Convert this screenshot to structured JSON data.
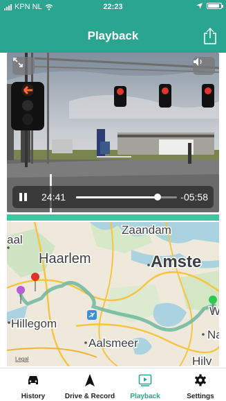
{
  "status_bar": {
    "carrier": "KPN NL",
    "time": "22:23",
    "battery_level": 0.9,
    "signal_bars": 4,
    "icons": [
      "wifi-icon",
      "location-arrow-icon",
      "battery-icon"
    ]
  },
  "nav": {
    "title": "Playback",
    "share_icon": "share-icon"
  },
  "video": {
    "fullscreen_icon": "expand-icon",
    "volume_icon": "speaker-icon",
    "elapsed": "24:41",
    "remaining": "-05:58",
    "progress": 0.81
  },
  "map": {
    "labels": {
      "zaandam": "Zaandam",
      "haarlem": "Haarlem",
      "amsterdam": "Amste",
      "hillegom": "Hillegom",
      "aalsmeer": "Aalsmeer",
      "aal": "aal",
      "na": "Na",
      "w": "W",
      "hilv": "Hilv",
      "legal": "Legal"
    },
    "pin_colors": {
      "start": "#2ec94f",
      "end": "#e0302a",
      "waypoint": "#b85bd6"
    },
    "route_color": "#6fb79f"
  },
  "tabs": [
    {
      "label": "History",
      "icon": "car-icon",
      "active": false
    },
    {
      "label": "Drive & Record",
      "icon": "navigation-arrow-icon",
      "active": false
    },
    {
      "label": "Playback",
      "icon": "play-square-icon",
      "active": true
    },
    {
      "label": "Settings",
      "icon": "gear-icon",
      "active": false
    }
  ],
  "colors": {
    "accent": "#2aa58f",
    "divider": "#36c9a2"
  }
}
